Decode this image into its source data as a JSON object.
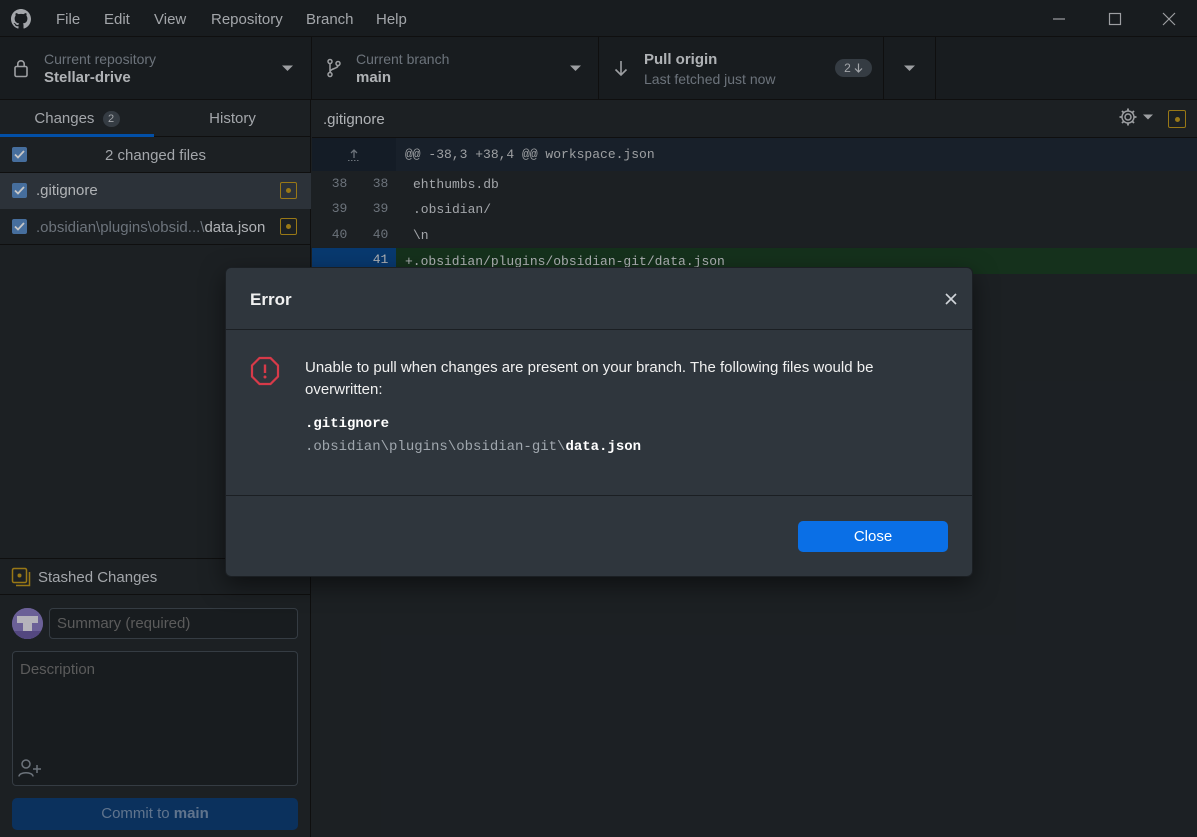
{
  "menu": [
    "File",
    "Edit",
    "View",
    "Repository",
    "Branch",
    "Help"
  ],
  "toolbar": {
    "repo_label": "Current repository",
    "repo_value": "Stellar-drive",
    "branch_label": "Current branch",
    "branch_value": "main",
    "pull_title": "Pull origin",
    "pull_sub": "Last fetched just now",
    "pull_count": "2"
  },
  "tabs": {
    "changes": "Changes",
    "changes_count": "2",
    "history": "History"
  },
  "changes": {
    "summary": "2 changed files",
    "files": [
      {
        "dir": "",
        "name": ".gitignore"
      },
      {
        "dir": ".obsidian\\plugins\\obsid...\\",
        "name": "data.json"
      }
    ]
  },
  "stash": {
    "label": "Stashed Changes"
  },
  "commit": {
    "summary_placeholder": "Summary (required)",
    "description_placeholder": "Description",
    "button_prefix": "Commit to ",
    "button_branch": "main"
  },
  "diff": {
    "filename": ".gitignore",
    "hunk": "@@ -38,3 +38,4 @@ workspace.json",
    "lines": [
      {
        "old": "38",
        "new": "38",
        "text": "ehthumbs.db"
      },
      {
        "old": "39",
        "new": "39",
        "text": ".obsidian/"
      },
      {
        "old": "40",
        "new": "40",
        "text": "\\n"
      },
      {
        "old": "",
        "new": "41",
        "text": "+.obsidian/plugins/obsidian-git/data.json"
      }
    ]
  },
  "dialog": {
    "title": "Error",
    "message": "Unable to pull when changes are present on your branch. The following files would be overwritten:",
    "file1": ".gitignore",
    "file2_dir": ".obsidian\\plugins\\obsidian-git\\",
    "file2_name": "data.json",
    "close_label": "Close"
  },
  "colors": {
    "accent": "#0366d6",
    "error": "#d73a49",
    "modified": "#c49a1d",
    "added_bg": "#1b3f24"
  }
}
